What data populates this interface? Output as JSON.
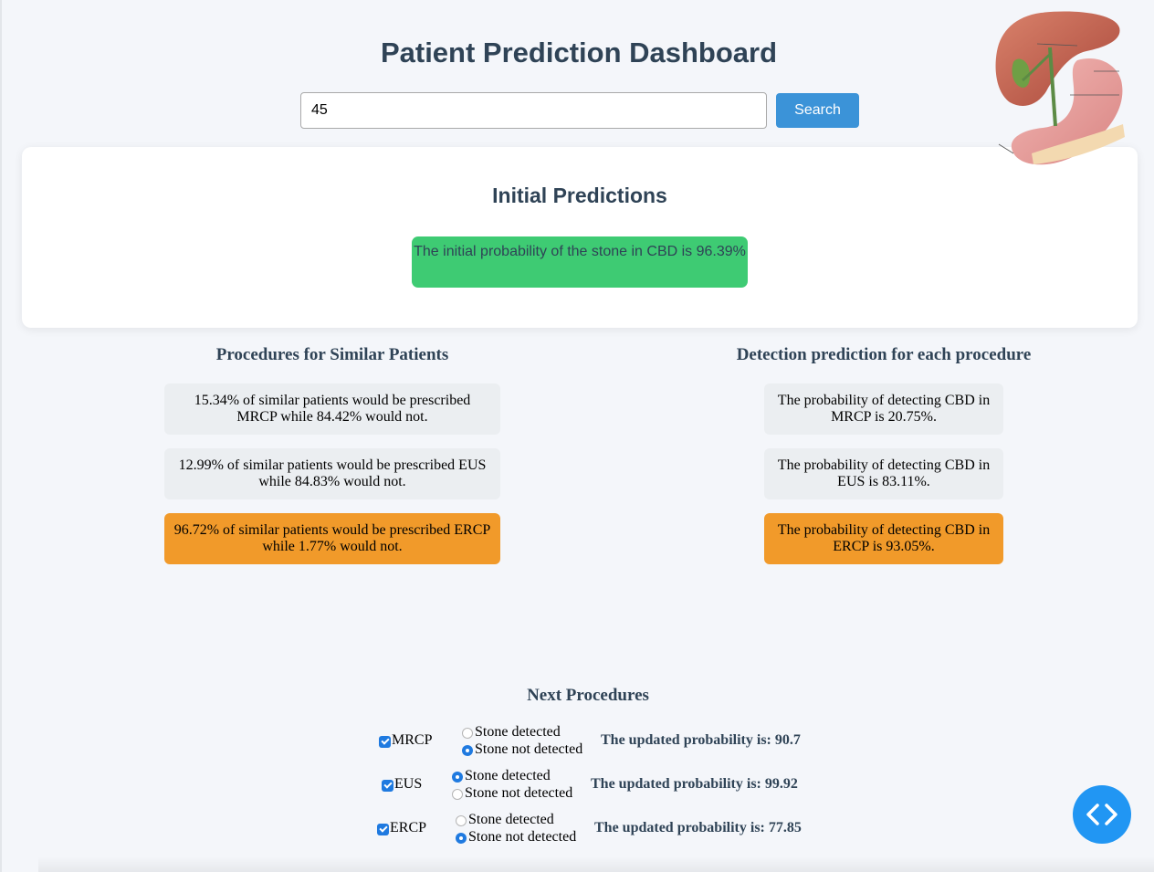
{
  "header": {
    "title": "Patient Prediction Dashboard"
  },
  "search": {
    "value": "45",
    "button_label": "Search"
  },
  "initial": {
    "heading": "Initial Predictions",
    "text": "The initial probability of the stone in CBD is 96.39%"
  },
  "similar": {
    "heading": "Procedures for Similar Patients",
    "items": [
      "15.34% of similar patients would be prescribed MRCP while 84.42% would not.",
      "12.99% of similar patients would be prescribed EUS while 84.83% would not.",
      "96.72% of similar patients would be prescribed ERCP while 1.77% would not."
    ]
  },
  "detection": {
    "heading": "Detection prediction for each procedure",
    "items": [
      "The probability of detecting CBD in MRCP is 20.75%.",
      "The probability of detecting CBD in EUS is 83.11%.",
      "The probability of detecting CBD in ERCP is 93.05%."
    ]
  },
  "next": {
    "heading": "Next Procedures",
    "option_detected": "Stone detected",
    "option_not_detected": "Stone not detected",
    "rows": [
      {
        "name": "MRCP",
        "checked": true,
        "selected": "Stone not detected",
        "updated": "The updated probability is: 90.7"
      },
      {
        "name": "EUS",
        "checked": true,
        "selected": "Stone detected",
        "updated": "The updated probability is: 99.92"
      },
      {
        "name": "ERCP",
        "checked": true,
        "selected": "Stone not detected",
        "updated": "The updated probability is: 77.85"
      }
    ]
  },
  "colors": {
    "primary_text": "#2f4356",
    "search_button": "#3b93d8",
    "initial_box": "#3ecb73",
    "highlight_box": "#f19a2a",
    "neutral_box": "#ebeef1",
    "fab": "#2196f3"
  },
  "icons": {
    "fab": "code-brackets-icon",
    "illustration": "liver-stomach-illustration"
  }
}
